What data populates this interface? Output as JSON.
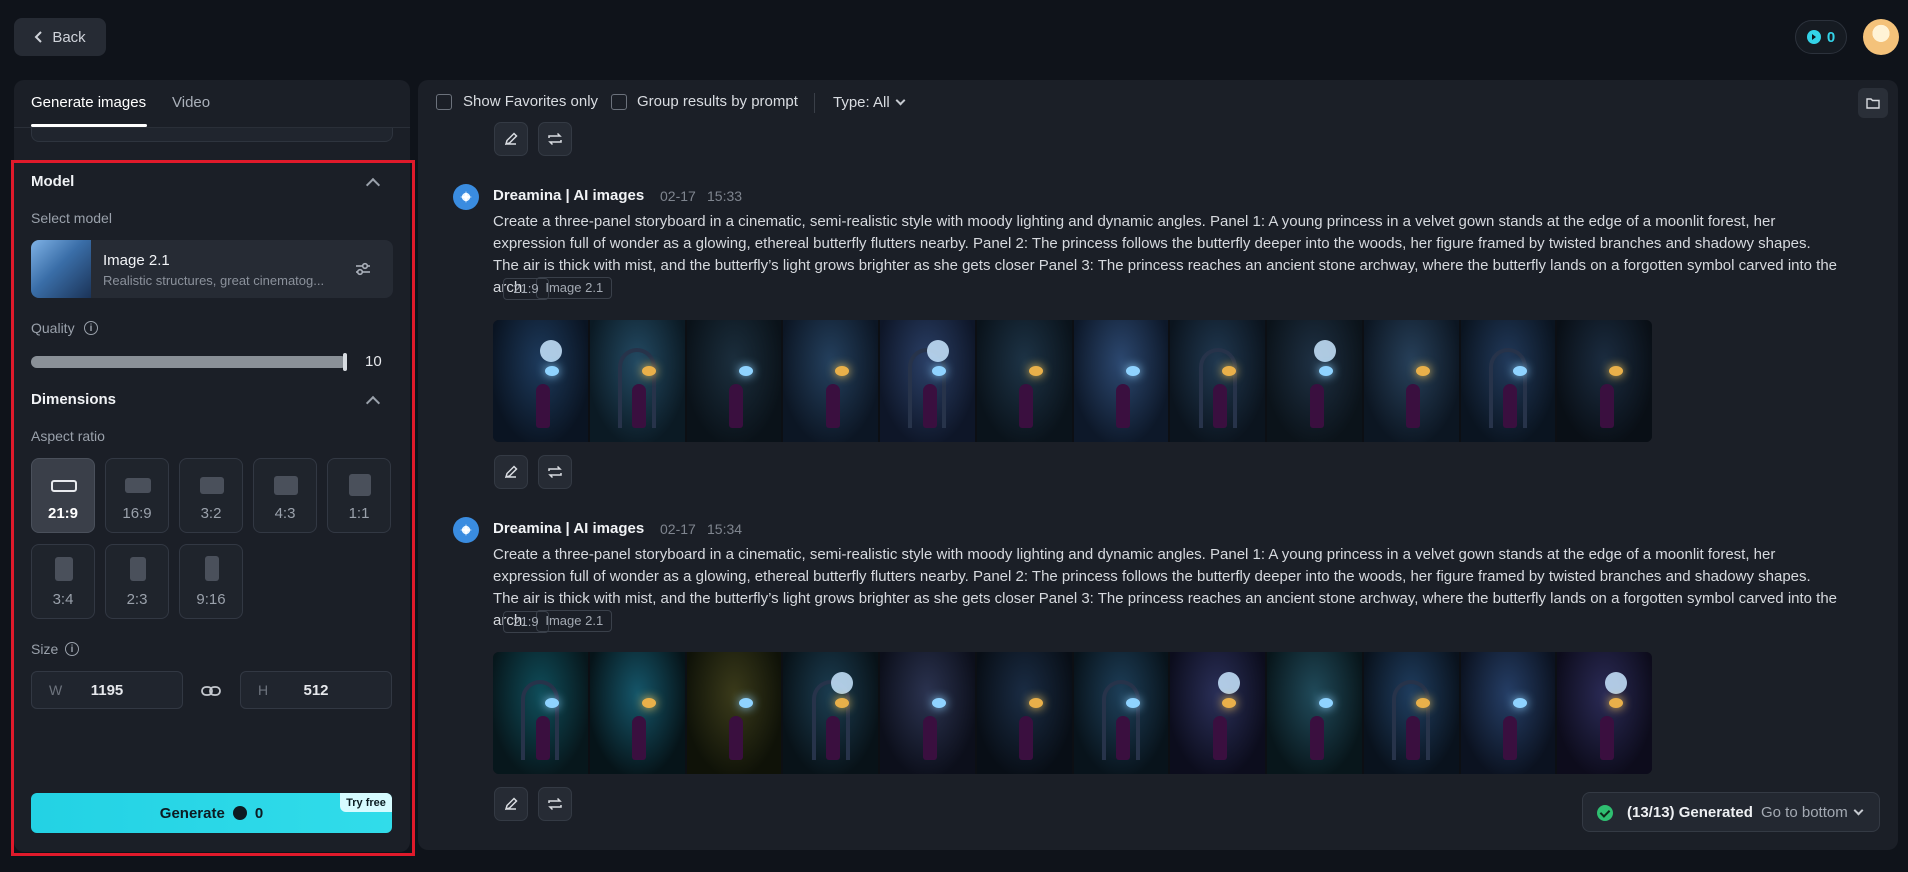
{
  "topbar": {
    "back_label": "Back",
    "credits": "0"
  },
  "tabs": [
    {
      "label": "Generate images",
      "active": true
    },
    {
      "label": "Video",
      "active": false
    }
  ],
  "model_section": {
    "title": "Model",
    "select_label": "Select model",
    "model_name": "Image 2.1",
    "model_desc": "Realistic structures, great cinematog..."
  },
  "quality": {
    "label": "Quality",
    "value": "10",
    "fraction": 1.0
  },
  "dimensions": {
    "title": "Dimensions",
    "aspect_label": "Aspect ratio",
    "ratios": [
      {
        "label": "21:9",
        "selected": true
      },
      {
        "label": "16:9",
        "selected": false
      },
      {
        "label": "3:2",
        "selected": false
      },
      {
        "label": "4:3",
        "selected": false
      },
      {
        "label": "1:1",
        "selected": false
      },
      {
        "label": "3:4",
        "selected": false
      },
      {
        "label": "2:3",
        "selected": false
      },
      {
        "label": "9:16",
        "selected": false
      }
    ],
    "size_label": "Size",
    "width_prefix": "W",
    "width_value": "1195",
    "height_prefix": "H",
    "height_value": "512"
  },
  "generate": {
    "label": "Generate",
    "credits": "0",
    "badge": "Try free"
  },
  "toolbar": {
    "favorites_label": "Show Favorites only",
    "group_label": "Group results by prompt",
    "type_label": "Type: All"
  },
  "messages": [
    {
      "sender": "Dreamina | AI images",
      "date": "02-17",
      "time": "15:33",
      "prompt": "Create a three-panel storyboard in a cinematic, semi-realistic style with moody lighting and dynamic angles. Panel 1: A young princess in a velvet gown stands at the edge of a moonlit forest, her expression full of wonder as a glowing, ethereal butterfly flutters nearby. Panel 2: The princess follows the butterfly deeper into the woods, her figure framed by twisted branches and shadowy shapes. The air is thick with mist, and the butterfly’s light grows brighter as she gets closer Panel 3: The princess reaches an ancient stone archway, where the butterfly lands on a forgotten symbol carved into the arch.",
      "model_tag": "Image 2.1",
      "ratio_tag": "21:9"
    },
    {
      "sender": "Dreamina | AI images",
      "date": "02-17",
      "time": "15:34",
      "prompt": "Create a three-panel storyboard in a cinematic, semi-realistic style with moody lighting and dynamic angles. Panel 1: A young princess in a velvet gown stands at the edge of a moonlit forest, her expression full of wonder as a glowing, ethereal butterfly flutters nearby. Panel 2: The princess follows the butterfly deeper into the woods, her figure framed by twisted branches and shadowy shapes. The air is thick with mist, and the butterfly’s light grows brighter as she gets closer Panel 3: The princess reaches an ancient stone archway, where the butterfly lands on a forgotten symbol carved into the arch.",
      "model_tag": "Image 2.1",
      "ratio_tag": "21:9"
    }
  ],
  "toast": {
    "status": "(13/13) Generated",
    "link": "Go to bottom"
  },
  "colors": {
    "accent": "#23d2e4",
    "highlight": "#e01a2b",
    "success": "#2fbf71"
  }
}
